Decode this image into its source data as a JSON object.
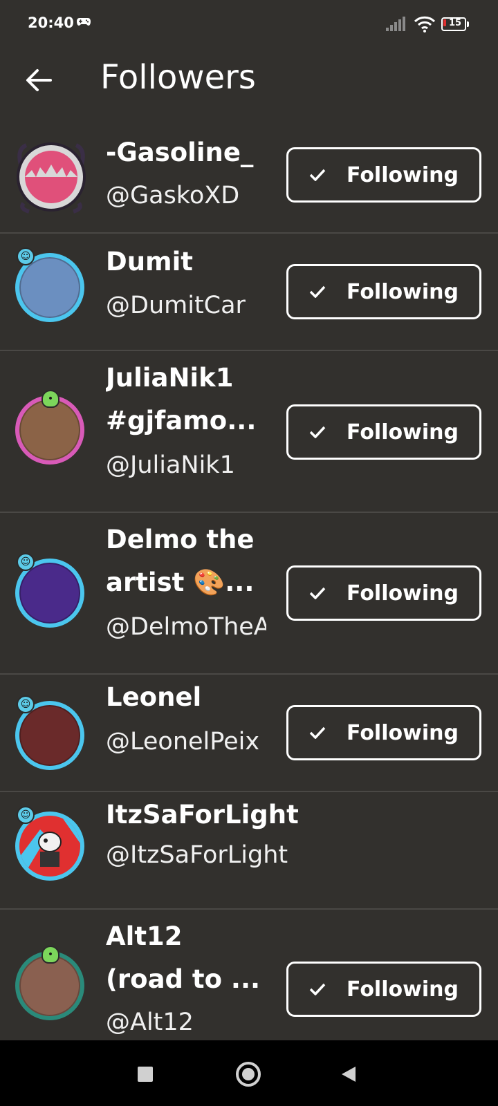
{
  "status_bar": {
    "time": "20:40",
    "battery": "15"
  },
  "header": {
    "title": "Followers"
  },
  "followers": [
    {
      "name": "-Gasoline_",
      "handle": "@GaskoXD",
      "button": "Following",
      "avatar_color": "#e0507a",
      "ring_color": "#3a2e46"
    },
    {
      "name": "Dumit",
      "handle": "@DumitCar",
      "button": "Following",
      "avatar_color": "#6b8fc0",
      "ring_color": "#4bc6ee"
    },
    {
      "name": "JuliaNik1 #gjfamo...",
      "handle": "@JuliaNik1",
      "button": "Following",
      "avatar_color": "#8b6347",
      "ring_color": "#d85ab8"
    },
    {
      "name": "Delmo the artist 🎨...",
      "handle": "@DelmoTheA",
      "button": "Following",
      "avatar_color": "#4a2a8a",
      "ring_color": "#4bc6ee"
    },
    {
      "name": "Leonel",
      "handle": "@LeonelPeix",
      "button": "Following",
      "avatar_color": "#6a2a2a",
      "ring_color": "#4bc6ee"
    },
    {
      "name": "ItzSaForLight",
      "handle": "@ItzSaForLight",
      "button": "",
      "avatar_color": "#e03030",
      "ring_color": "#4bc6ee"
    },
    {
      "name": "Alt12 (road to ...",
      "handle": "@Alt12",
      "button": "Following",
      "avatar_color": "#8a6050",
      "ring_color": "#2a8a7a"
    }
  ]
}
